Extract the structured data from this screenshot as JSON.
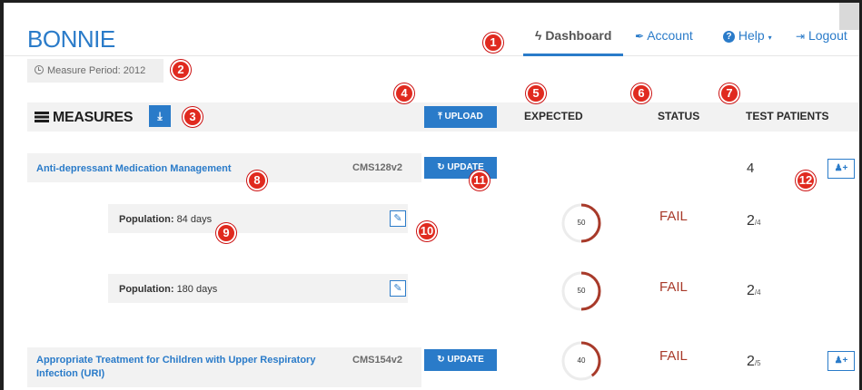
{
  "app": {
    "brand": "BONNIE",
    "measure_period": "Measure Period: 2012"
  },
  "nav": {
    "dashboard": "Dashboard",
    "account": "Account",
    "help": "Help",
    "logout": "Logout"
  },
  "header": {
    "title": "MEASURES",
    "download_icon": "download-icon",
    "upload_label": "UPLOAD",
    "columns": {
      "expected": "EXPECTED",
      "status": "STATUS",
      "test_patients": "TEST PATIENTS"
    }
  },
  "measures": [
    {
      "name": "Anti-depressant Medication Management",
      "cms_id": "CMS128v2",
      "update_label": "UPDATE",
      "patient_count": "4",
      "populations": [
        {
          "label": "Population:",
          "value": "84 days",
          "gauge_value": "50",
          "status": "FAIL",
          "passed": "2",
          "total": "/4"
        },
        {
          "label": "Population:",
          "value": "180 days",
          "gauge_value": "50",
          "status": "FAIL",
          "passed": "2",
          "total": "/4"
        }
      ]
    },
    {
      "name_line1": "Appropriate Treatment for Children with Upper Respiratory",
      "name_line2": "Infection (URI)",
      "cms_id": "CMS154v2",
      "update_label": "UPDATE",
      "gauge_value": "40",
      "status": "FAIL",
      "passed": "2",
      "total": "/5"
    }
  ],
  "callouts": [
    "1",
    "2",
    "3",
    "4",
    "5",
    "6",
    "7",
    "8",
    "9",
    "10",
    "11",
    "12"
  ],
  "colors": {
    "accent": "#2a7bc9",
    "fail": "#a83a2a",
    "callout": "#e02a1f"
  }
}
